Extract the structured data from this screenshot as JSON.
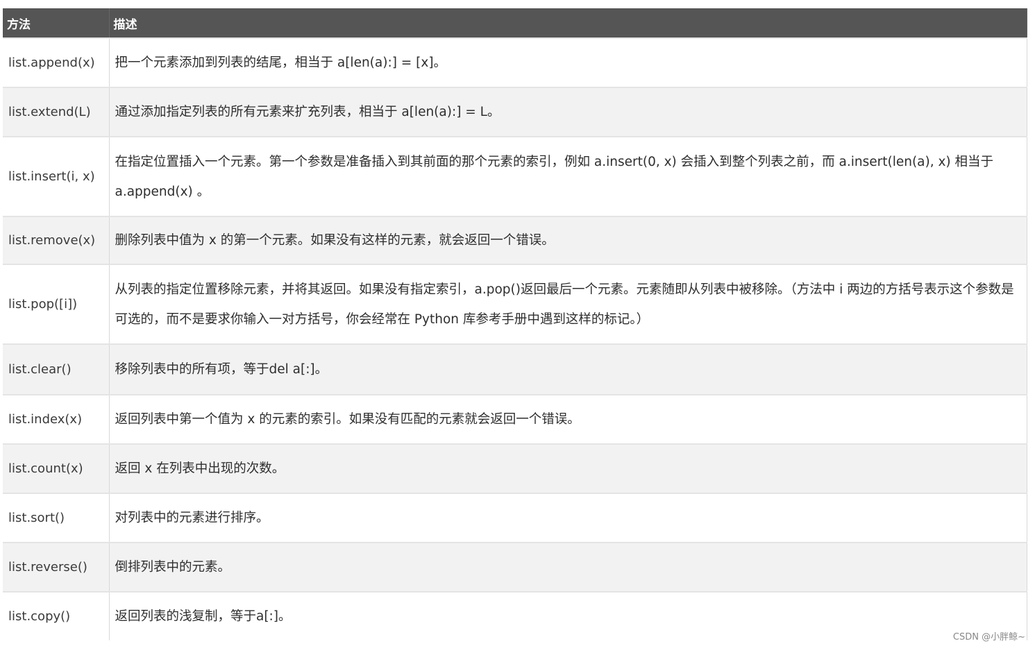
{
  "table": {
    "headers": [
      "方法",
      "描述"
    ],
    "rows": [
      {
        "method": "list.append(x)",
        "desc": "把一个元素添加到列表的结尾，相当于 a[len(a):] = [x]。"
      },
      {
        "method": "list.extend(L)",
        "desc": "通过添加指定列表的所有元素来扩充列表，相当于 a[len(a):] = L。"
      },
      {
        "method": "list.insert(i, x)",
        "desc": "在指定位置插入一个元素。第一个参数是准备插入到其前面的那个元素的索引，例如 a.insert(0, x) 会插入到整个列表之前，而 a.insert(len(a), x) 相当于 a.append(x) 。"
      },
      {
        "method": "list.remove(x)",
        "desc": "删除列表中值为 x 的第一个元素。如果没有这样的元素，就会返回一个错误。"
      },
      {
        "method": "list.pop([i])",
        "desc": "从列表的指定位置移除元素，并将其返回。如果没有指定索引，a.pop()返回最后一个元素。元素随即从列表中被移除。（方法中 i 两边的方括号表示这个参数是可选的，而不是要求你输入一对方括号，你会经常在 Python 库参考手册中遇到这样的标记。）"
      },
      {
        "method": "list.clear()",
        "desc": "移除列表中的所有项，等于del a[:]。"
      },
      {
        "method": "list.index(x)",
        "desc": "返回列表中第一个值为 x 的元素的索引。如果没有匹配的元素就会返回一个错误。"
      },
      {
        "method": "list.count(x)",
        "desc": "返回 x 在列表中出现的次数。"
      },
      {
        "method": "list.sort()",
        "desc": "对列表中的元素进行排序。"
      },
      {
        "method": "list.reverse()",
        "desc": "倒排列表中的元素。"
      },
      {
        "method": "list.copy()",
        "desc": "返回列表的浅复制，等于a[:]。"
      }
    ]
  },
  "watermark": "CSDN @小胖鲸~"
}
